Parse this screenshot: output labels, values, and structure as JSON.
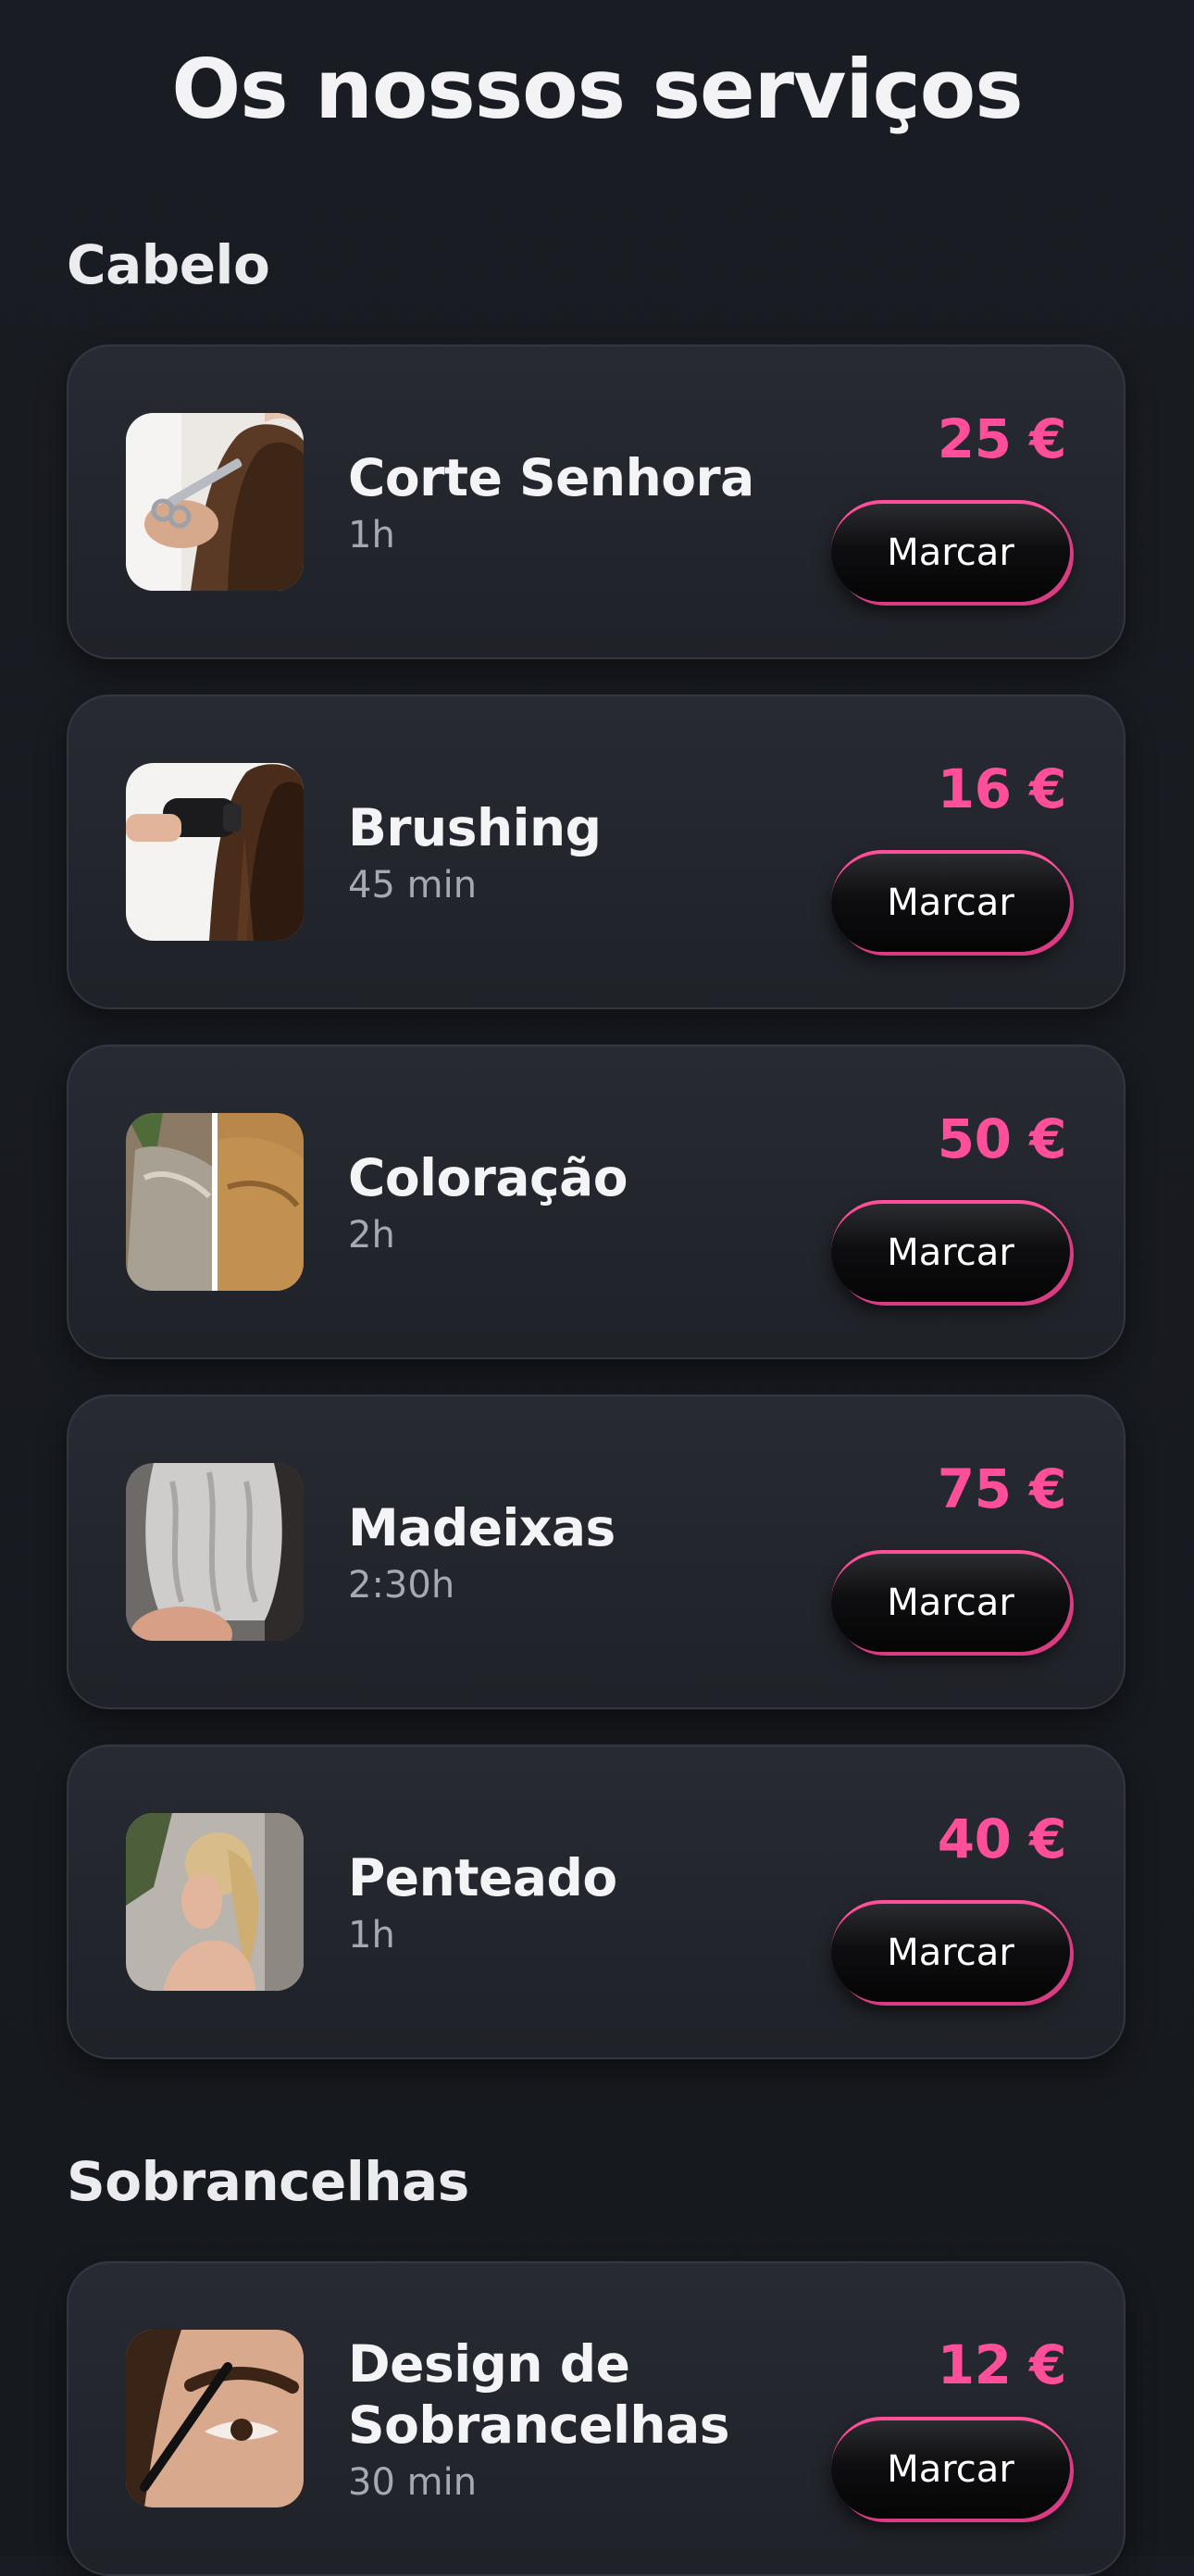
{
  "page": {
    "title": "Os nossos serviços"
  },
  "colors": {
    "background": "#191c22",
    "card": "#24272e",
    "price": "#ff4f9a",
    "button": "#0e0e10",
    "button_accent": "#ff4f9a",
    "muted_text": "#a6a9b2"
  },
  "sections": [
    {
      "title": "Cabelo",
      "services": [
        {
          "name": "Corte Senhora",
          "duration": "1h",
          "price": "25 €",
          "button": "Marcar",
          "image": "haircut-photo"
        },
        {
          "name": "Brushing",
          "duration": "45 min",
          "price": "16 €",
          "button": "Marcar",
          "image": "blow-dry-photo"
        },
        {
          "name": "Coloração",
          "duration": "2h",
          "price": "50 €",
          "button": "Marcar",
          "image": "hair-color-before-after-photo"
        },
        {
          "name": "Madeixas",
          "duration": "2:30h",
          "price": "75 €",
          "button": "Marcar",
          "image": "highlights-photo"
        },
        {
          "name": "Penteado",
          "duration": "1h",
          "price": "40 €",
          "button": "Marcar",
          "image": "updo-hairstyle-photo"
        }
      ]
    },
    {
      "title": "Sobrancelhas",
      "services": [
        {
          "name": "Design de Sobrancelhas",
          "duration": "30 min",
          "price": "12 €",
          "button": "Marcar",
          "image": "eyebrow-design-photo"
        }
      ]
    }
  ]
}
